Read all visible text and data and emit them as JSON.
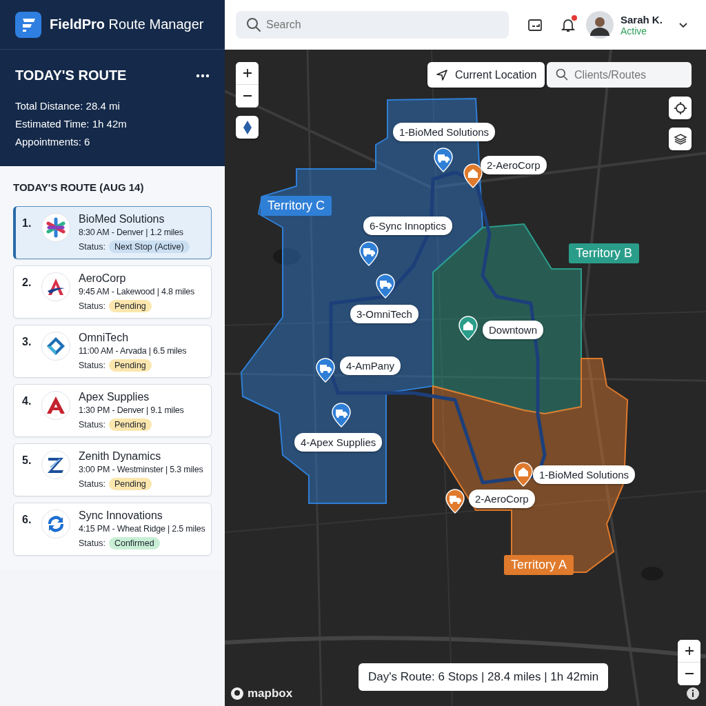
{
  "app": {
    "title": "**FieldPro** Route Manager"
  },
  "summary": {
    "title": "TODAY'S ROUTE",
    "stats": [
      "Total Distance: 28.4 mi",
      "Estimated Time: 1h 42m",
      "Appointments: 6"
    ]
  },
  "route_list": {
    "heading": "TODAY'S ROUTE (AUG 14)",
    "stops": [
      {
        "number": "1.",
        "name": "BioMed Solutions",
        "details": "8:30 AM - Denver | 1.2 miles",
        "status_label": "Status:",
        "status": "Next Stop (Active)",
        "color": "#cadff1",
        "selected": true
      },
      {
        "number": "2.",
        "name": "AeroCorp",
        "details": "9:45 AM - Lakewood | 4.8 miles",
        "status_label": "Status:",
        "status": "Pending",
        "color": "#fbe6ad",
        "selected": false
      },
      {
        "number": "3.",
        "name": "OmniTech",
        "details": "11:00 AM - Arvada | 6.5 miles",
        "status_label": "Status:",
        "status": "Pending",
        "color": "#fbe6ad",
        "selected": false
      },
      {
        "number": "4.",
        "name": "Apex Supplies",
        "details": "1:30 PM - Denver | 9.1 miles",
        "status_label": "Status:",
        "status": "Pending",
        "color": "#fbe6ad",
        "selected": false
      },
      {
        "number": "5.",
        "name": "Zenith Dynamics",
        "details": "3:00 PM - Westminster | 5.3 miles",
        "status_label": "Status:",
        "status": "Pending",
        "color": "#fbe6ad",
        "selected": false
      },
      {
        "number": "6.",
        "name": "Sync Innovations",
        "details": "4:15 PM - Wheat Ridge | 2.5 miles",
        "status_label": "Status:",
        "status": "Confirmed",
        "color": "#c8efd6",
        "selected": false
      }
    ]
  },
  "header": {
    "search_placeholder": "Search",
    "notifications_unread": true,
    "user": {
      "name": "Sarah K.",
      "status": "Active"
    }
  },
  "map": {
    "current_location": "Current Location",
    "search_placeholder": "Clients/Routes",
    "territories": [
      {
        "label": "Territory C",
        "color": "#2f7fd6"
      },
      {
        "label": "Territory B",
        "color": "#2a9d8a"
      },
      {
        "label": "Territory A",
        "color": "#e07a2c"
      }
    ],
    "markers": [
      {
        "kind": "truck",
        "color": "#2f7fd6",
        "label": "1-BioMed Solutions"
      },
      {
        "kind": "home",
        "color": "#e07a2c",
        "label": "2-AeroCorp"
      },
      {
        "kind": "truck",
        "color": "#2f7fd6",
        "label": "6-Sync Innoptics"
      },
      {
        "kind": "truck",
        "color": "#2f7fd6",
        "label": "3-OmniTech"
      },
      {
        "kind": "home",
        "color": "#2a9d8a",
        "label": "Downtown"
      },
      {
        "kind": "truck",
        "color": "#2f7fd6",
        "label": "4-AmPany"
      },
      {
        "kind": "truck",
        "color": "#2f7fd6",
        "label": "4-Apex Supplies"
      },
      {
        "kind": "home",
        "color": "#e07a2c",
        "label": "1-BioMed Solutions"
      },
      {
        "kind": "truck",
        "color": "#e07a2c",
        "label": "2-AeroCorp"
      }
    ],
    "footer": "Day's Route: 6 Stops | 28.4 miles | 1h 42min",
    "attribution": "mapbox"
  }
}
